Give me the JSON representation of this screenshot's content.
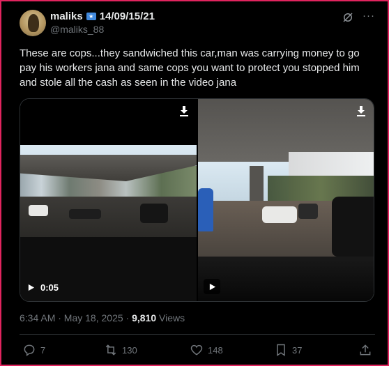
{
  "tweet": {
    "author_name": "maliks",
    "author_suffix": "14/09/15/21",
    "handle": "@maliks_88",
    "text": "These are cops...they sandwiched this car,man was carrying money to go pay his workers jana and same cops you want to protect you stopped him and stole all the cash as seen in the video jana",
    "timestamp": "6:34 AM · May 18, 2025 · ",
    "views_count": "9,810",
    "views_label": " Views"
  },
  "media": {
    "videos": [
      {
        "duration": "0:05",
        "download_icon": "download-icon",
        "play_icon": "play-icon"
      },
      {
        "duration": "",
        "download_icon": "download-icon",
        "play_icon": "play-icon"
      }
    ]
  },
  "actions": {
    "replies": "7",
    "reposts": "130",
    "likes": "148",
    "bookmarks": "37"
  },
  "colors": {
    "background": "#000000",
    "text": "#e7e9ea",
    "muted": "#71767b",
    "border_highlight": "#e0245e",
    "divider": "#2f3336"
  }
}
